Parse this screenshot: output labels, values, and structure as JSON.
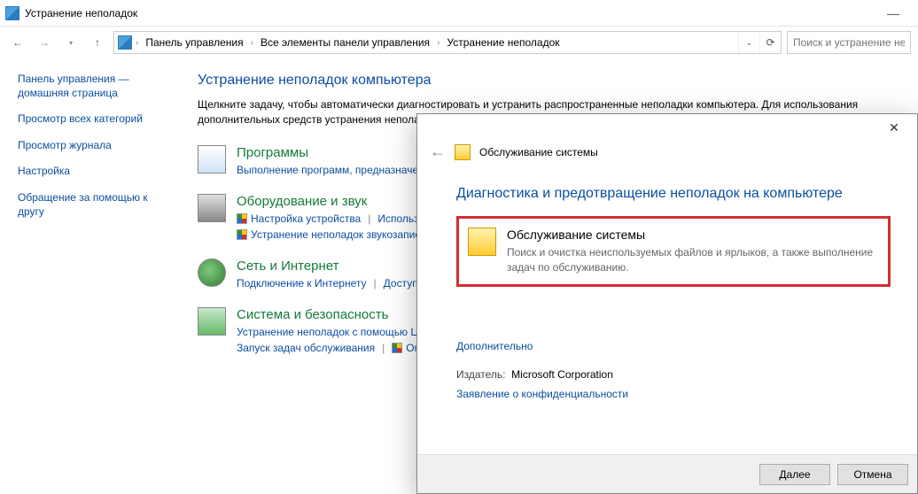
{
  "window": {
    "title": "Устранение неполадок",
    "minimize_icon": "minimize",
    "search_placeholder": "Поиск и устранение не"
  },
  "breadcrumbs": [
    "Панель управления",
    "Все элементы панели управления",
    "Устранение неполадок"
  ],
  "sidebar": {
    "items": [
      "Панель управления — домашняя страница",
      "Просмотр всех категорий",
      "Просмотр журнала",
      "Настройка",
      "Обращение за помощью к другу"
    ]
  },
  "main": {
    "heading": "Устранение неполадок компьютера",
    "intro": "Щелкните задачу, чтобы автоматически диагностировать и устранить распространенные неполадки компьютера. Для использования дополнительных средств устранения неполадок щелкните категорию или воспользуйтесь ссылкой \"Просмотр всех категорий\"."
  },
  "categories": [
    {
      "title": "Программы",
      "links": [
        "Выполнение программ, предназначенных для предыдущих версий Windows"
      ],
      "shields": [
        false
      ]
    },
    {
      "title": "Оборудование и звук",
      "links": [
        "Настройка устройства",
        "Использование принтера",
        "Устранение неполадок звукозаписи"
      ],
      "shields": [
        true,
        false,
        true
      ]
    },
    {
      "title": "Сеть и Интернет",
      "links": [
        "Подключение к Интернету",
        "Доступ к общим файлам и папкам на других компьютерах"
      ],
      "shields": [
        false,
        false
      ]
    },
    {
      "title": "Система и безопасность",
      "links": [
        "Устранение неполадок с помощью Центра обновления Windows",
        "Запуск задач обслуживания",
        "Оптимизация энергопотребления"
      ],
      "shields": [
        false,
        false,
        true
      ]
    }
  ],
  "wizard": {
    "header_label": "Обслуживание системы",
    "title": "Диагностика и предотвращение неполадок на компьютере",
    "option_title": "Обслуживание системы",
    "option_desc": "Поиск и очистка неиспользуемых файлов и ярлыков, а также выполнение задач по обслуживанию.",
    "advanced": "Дополнительно",
    "publisher_label": "Издатель:",
    "publisher_value": "Microsoft Corporation",
    "privacy": "Заявление о конфиденциальности",
    "next": "Далее",
    "cancel": "Отмена"
  }
}
